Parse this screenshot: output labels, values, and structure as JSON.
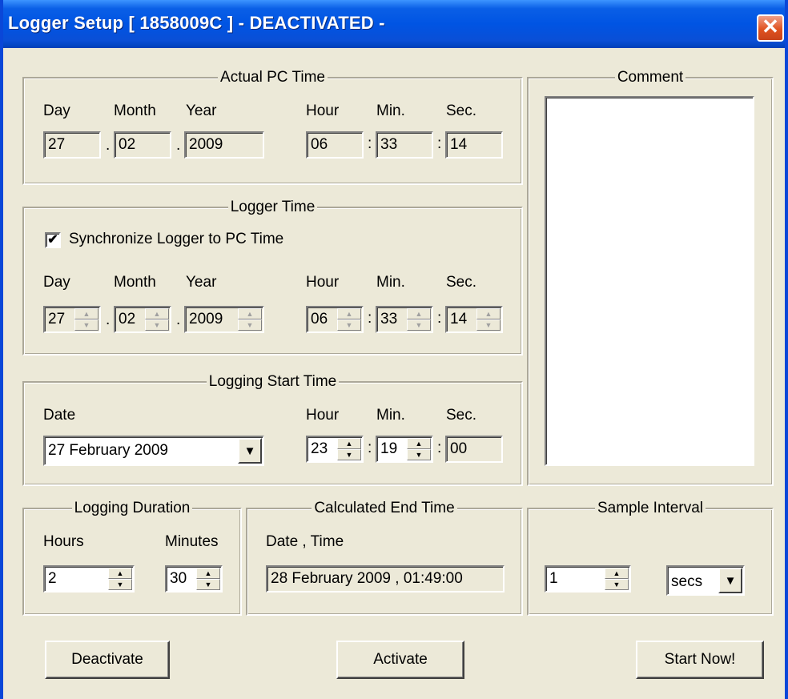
{
  "window": {
    "title": "Logger Setup [ 1858009C ] - DEACTIVATED -",
    "close_glyph": "✕"
  },
  "actual_pc_time": {
    "legend": "Actual PC Time",
    "labels": {
      "day": "Day",
      "month": "Month",
      "year": "Year",
      "hour": "Hour",
      "min": "Min.",
      "sec": "Sec."
    },
    "values": {
      "day": "27",
      "month": "02",
      "year": "2009",
      "hour": "06",
      "min": "33",
      "sec": "14"
    }
  },
  "logger_time": {
    "legend": "Logger Time",
    "sync_label": "Synchronize Logger to PC Time",
    "sync_checked": true,
    "labels": {
      "day": "Day",
      "month": "Month",
      "year": "Year",
      "hour": "Hour",
      "min": "Min.",
      "sec": "Sec."
    },
    "values": {
      "day": "27",
      "month": "02",
      "year": "2009",
      "hour": "06",
      "min": "33",
      "sec": "14"
    }
  },
  "logging_start": {
    "legend": "Logging Start Time",
    "labels": {
      "date": "Date",
      "hour": "Hour",
      "min": "Min.",
      "sec": "Sec."
    },
    "date": "27 February 2009",
    "hour": "23",
    "min": "19",
    "sec": "00"
  },
  "comment": {
    "legend": "Comment",
    "text": ""
  },
  "logging_duration": {
    "legend": "Logging Duration",
    "labels": {
      "hours": "Hours",
      "minutes": "Minutes"
    },
    "hours": "2",
    "minutes": "30"
  },
  "calc_end": {
    "legend": "Calculated End Time",
    "label": "Date , Time",
    "value": "28 February 2009 , 01:49:00"
  },
  "sample_interval": {
    "legend": "Sample Interval",
    "value": "1",
    "unit": "secs"
  },
  "separators": {
    "dot": ".",
    "colon": ":"
  },
  "glyphs": {
    "up": "▲",
    "down": "▼",
    "drop": "▼",
    "check": "✔"
  },
  "buttons": {
    "deactivate": "Deactivate",
    "activate": "Activate",
    "start_now": "Start Now!"
  }
}
